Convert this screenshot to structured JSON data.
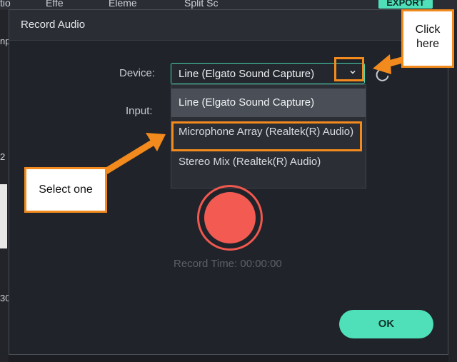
{
  "background_app": {
    "tabs": [
      "tio",
      "Effe",
      "Eleme",
      "Split Sc"
    ],
    "export_label": "EXPORT",
    "left_fragments": [
      "np",
      "2",
      "30"
    ]
  },
  "dialog": {
    "title": "Record Audio",
    "device_label": "Device:",
    "input_label": "Input:",
    "device_value": "Line (Elgato Sound Capture)",
    "dropdown_options": [
      "Line (Elgato Sound Capture)",
      "Microphone Array (Realtek(R) Audio)",
      "Stereo Mix (Realtek(R) Audio)"
    ],
    "selected_option_index": 0,
    "record_time": "Record Time: 00:00:00",
    "ok_label": "OK"
  },
  "annotations": {
    "click_here": [
      "Click",
      "here"
    ],
    "select_one": "Select one",
    "highlight_color": "#f28a1e"
  },
  "colors": {
    "accent": "#4fe0b9",
    "record": "#f25a52",
    "dialog_bg": "#202329"
  },
  "icons": {
    "dropdown": "chevron-down-icon",
    "refresh": "refresh-icon",
    "record": "record-button"
  }
}
